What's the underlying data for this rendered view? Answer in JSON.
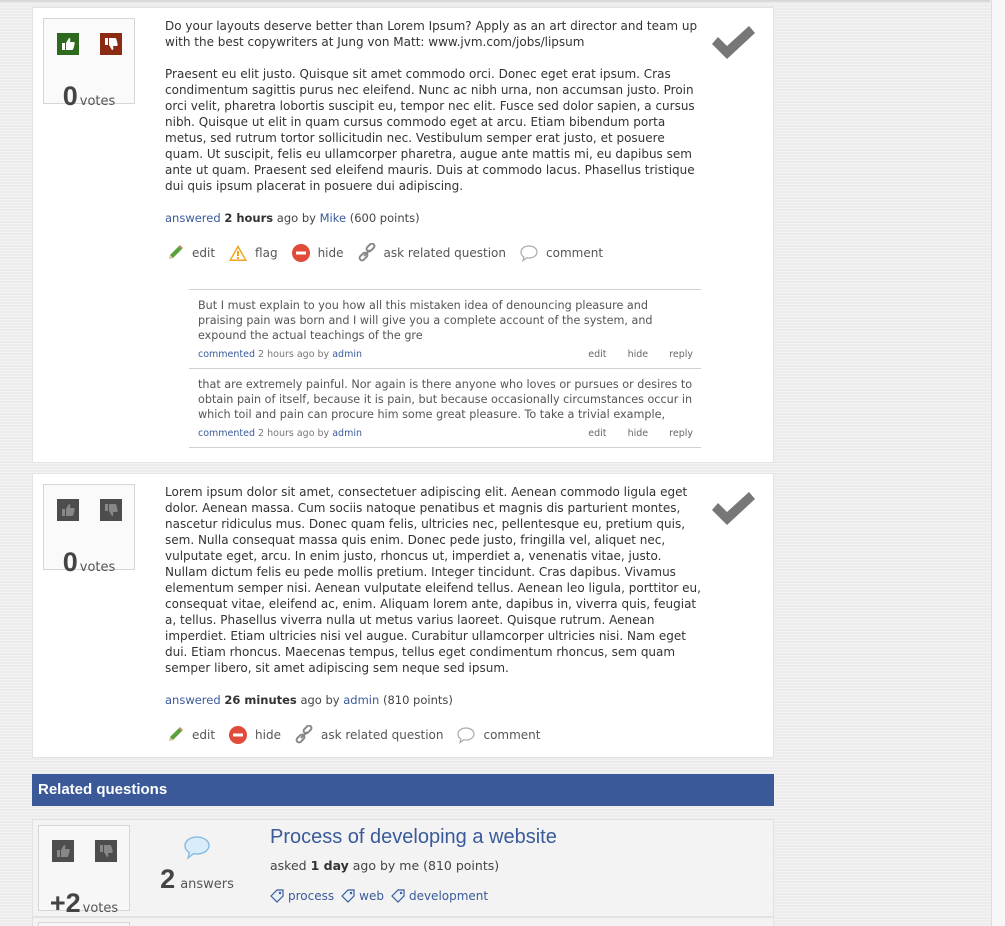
{
  "answers": [
    {
      "votes": "0",
      "votes_label": "votes",
      "paragraphs": [
        "Do your layouts deserve better than Lorem Ipsum? Apply as an art director and team up with the best copywriters at Jung von Matt: www.jvm.com/jobs/lipsum",
        "Praesent eu elit justo. Quisque sit amet commodo orci. Donec eget erat ipsum. Cras condimentum sagittis purus nec eleifend. Nunc ac nibh urna, non accumsan justo. Proin orci velit, pharetra lobortis suscipit eu, tempor nec elit. Fusce sed dolor sapien, a cursus nibh. Quisque ut elit in quam cursus commodo eget at arcu. Etiam bibendum porta metus, sed rutrum tortor sollicitudin nec. Vestibulum semper erat justo, et posuere quam. Ut suscipit, felis eu ullamcorper pharetra, augue ante mattis mi, eu dapibus sem ante ut quam. Praesent sed eleifend mauris. Duis at commodo lacus. Phasellus tristique dui quis ipsum placerat in posuere dui adipiscing."
      ],
      "meta": {
        "verb": "answered",
        "time": "2 hours",
        "ago_by": "ago by",
        "user": "Mike",
        "points": "(600 points)"
      },
      "actions": {
        "edit": "edit",
        "flag": "flag",
        "hide": "hide",
        "ask_related": "ask related question",
        "comment": "comment"
      },
      "comments": [
        {
          "text": "But I must explain to you how all this mistaken idea of denouncing pleasure and praising pain was born and I will give you a complete account of the system, and expound the actual teachings of the gre",
          "verb": "commented",
          "time": "2 hours ago by",
          "user": "admin",
          "edit": "edit",
          "hide": "hide",
          "reply": "reply"
        },
        {
          "text": "that are extremely painful. Nor again is there anyone who loves or pursues or desires to obtain pain of itself, because it is pain, but because occasionally circumstances occur in which toil and pain can procure him some great pleasure. To take a trivial example,",
          "verb": "commented",
          "time": "2 hours ago by",
          "user": "admin",
          "edit": "edit",
          "hide": "hide",
          "reply": "reply"
        }
      ]
    },
    {
      "votes": "0",
      "votes_label": "votes",
      "paragraphs": [
        "Lorem ipsum dolor sit amet, consectetuer adipiscing elit. Aenean commodo ligula eget dolor. Aenean massa. Cum sociis natoque penatibus et magnis dis parturient montes, nascetur ridiculus mus. Donec quam felis, ultricies nec, pellentesque eu, pretium quis, sem. Nulla consequat massa quis enim. Donec pede justo, fringilla vel, aliquet nec, vulputate eget, arcu. In enim justo, rhoncus ut, imperdiet a, venenatis vitae, justo. Nullam dictum felis eu pede mollis pretium. Integer tincidunt. Cras dapibus. Vivamus elementum semper nisi. Aenean vulputate eleifend tellus. Aenean leo ligula, porttitor eu, consequat vitae, eleifend ac, enim. Aliquam lorem ante, dapibus in, viverra quis, feugiat a, tellus. Phasellus viverra nulla ut metus varius laoreet. Quisque rutrum. Aenean imperdiet. Etiam ultricies nisi vel augue. Curabitur ullamcorper ultricies nisi. Nam eget dui. Etiam rhoncus. Maecenas tempus, tellus eget condimentum rhoncus, sem quam semper libero, sit amet adipiscing sem neque sed ipsum."
      ],
      "meta": {
        "verb": "answered",
        "time": "26 minutes",
        "ago_by": "ago by",
        "user": "admin",
        "points": "(810 points)"
      },
      "actions": {
        "edit": "edit",
        "hide": "hide",
        "ask_related": "ask related question",
        "comment": "comment"
      }
    }
  ],
  "related": {
    "header": "Related questions",
    "items": [
      {
        "votes": "+2",
        "votes_label": "votes",
        "answers": "2",
        "answers_label": "answers",
        "title": "Process of developing a website",
        "meta": {
          "verb": "asked",
          "time": "1 day",
          "rest": "ago by me (810 points)"
        },
        "tags": [
          "process",
          "web",
          "development"
        ]
      }
    ]
  },
  "colors": {
    "accent": "#3b5998",
    "link": "#3a5a9a",
    "vote_up_active": "#2e6a1d",
    "vote_down_active": "#8c2b14",
    "vote_inactive": "#4d4d4d"
  }
}
